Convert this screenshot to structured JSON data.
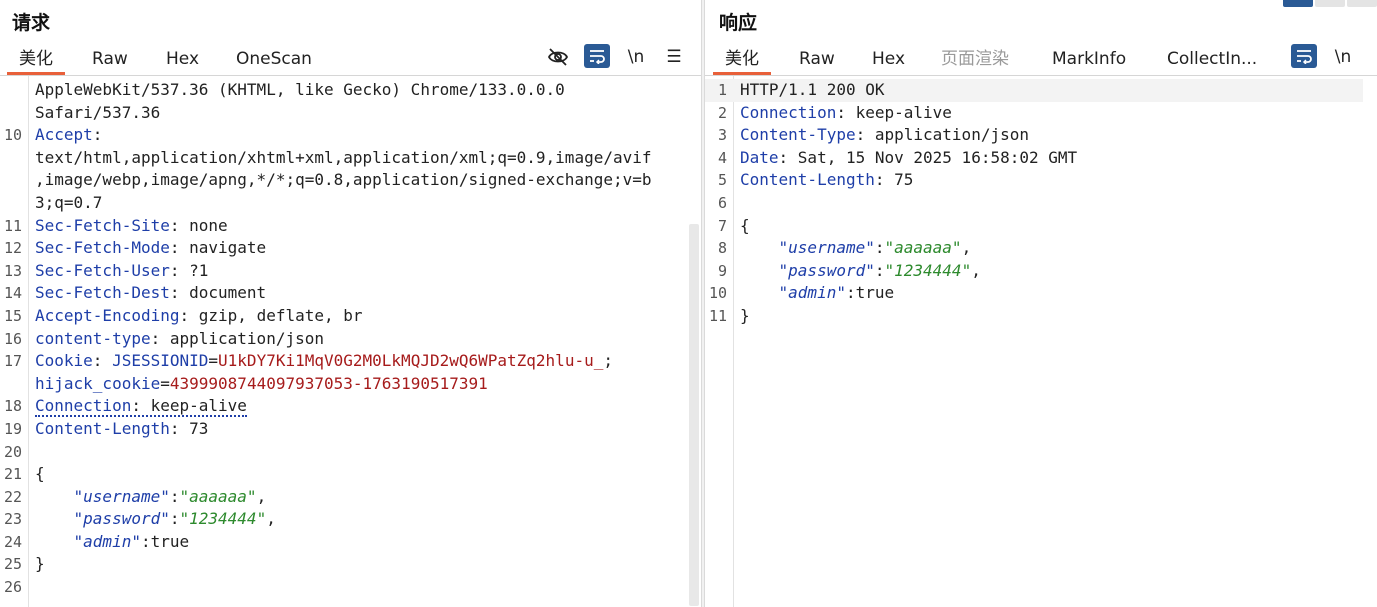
{
  "request": {
    "title": "请求",
    "tabs": [
      "美化",
      "Raw",
      "Hex",
      "OneScan"
    ],
    "tools": {
      "hide_icon": "eye-off-icon",
      "wrap_icon": "wrap-icon",
      "newline_label": "\\n",
      "menu_icon": "menu-icon"
    },
    "lines": [
      {
        "n": "",
        "text": "AppleWebKit/537.36 (KHTML, like Gecko) Chrome/133.0.0.0"
      },
      {
        "n": "",
        "text": "Safari/537.36"
      },
      {
        "n": "10",
        "key": "Accept",
        "sep": ":",
        "val": ""
      },
      {
        "n": "",
        "text": "text/html,application/xhtml+xml,application/xml;q=0.9,image/avif"
      },
      {
        "n": "",
        "text": ",image/webp,image/apng,*/*;q=0.8,application/signed-exchange;v=b"
      },
      {
        "n": "",
        "text": "3;q=0.7"
      },
      {
        "n": "11",
        "key": "Sec-Fetch-Site",
        "sep": ": ",
        "val": "none"
      },
      {
        "n": "12",
        "key": "Sec-Fetch-Mode",
        "sep": ": ",
        "val": "navigate"
      },
      {
        "n": "13",
        "key": "Sec-Fetch-User",
        "sep": ": ",
        "val": "?1"
      },
      {
        "n": "14",
        "key": "Sec-Fetch-Dest",
        "sep": ": ",
        "val": "document"
      },
      {
        "n": "15",
        "key": "Accept-Encoding",
        "sep": ": ",
        "val": "gzip, deflate, br"
      },
      {
        "n": "16",
        "key": "content-type",
        "sep": ": ",
        "val": "application/json"
      },
      {
        "n": "17",
        "key": "Cookie",
        "sep": ": ",
        "cookie": [
          {
            "k": "JSESSIONID",
            "v": "U1kDY7Ki1MqV0G2M0LkMQJD2wQ6WPatZq2hlu-u_",
            "tail": ";"
          }
        ]
      },
      {
        "n": "",
        "cookie": [
          {
            "k": "hijack_cookie",
            "v": "4399908744097937053-1763190517391",
            "tail": ""
          }
        ]
      },
      {
        "n": "18",
        "key": "Connection",
        "sep": ": ",
        "val": "keep-alive",
        "dotted": true
      },
      {
        "n": "19",
        "key": "Content-Length",
        "sep": ": ",
        "val": "73"
      },
      {
        "n": "20",
        "text": ""
      },
      {
        "n": "21",
        "text": "{"
      },
      {
        "n": "22",
        "indent": "    ",
        "jkey": "\"username\"",
        "jsep": ":",
        "jval": "\"aaaaaa\"",
        "jtail": ","
      },
      {
        "n": "23",
        "indent": "    ",
        "jkey": "\"password\"",
        "jsep": ":",
        "jval": "\"1234444\"",
        "jtail": ","
      },
      {
        "n": "24",
        "indent": "    ",
        "jkey": "\"admin\"",
        "jsep": ":",
        "jplain": "true",
        "jtail": ""
      },
      {
        "n": "25",
        "text": "}"
      },
      {
        "n": "26",
        "text": ""
      }
    ]
  },
  "response": {
    "title": "响应",
    "tabs": [
      "美化",
      "Raw",
      "Hex",
      "页面渲染",
      "MarkInfo",
      "CollectIn..."
    ],
    "tools": {
      "wrap_icon": "wrap-icon",
      "newline_label": "\\n"
    },
    "lines": [
      {
        "n": "1",
        "text": "HTTP/1.1 200 OK",
        "hl": true
      },
      {
        "n": "2",
        "key": "Connection",
        "sep": ": ",
        "val": "keep-alive"
      },
      {
        "n": "3",
        "key": "Content-Type",
        "sep": ": ",
        "val": "application/json"
      },
      {
        "n": "4",
        "key": "Date",
        "sep": ": ",
        "val": "Sat, 15 Nov 2025 16:58:02 GMT"
      },
      {
        "n": "5",
        "key": "Content-Length",
        "sep": ": ",
        "val": "75"
      },
      {
        "n": "6",
        "text": ""
      },
      {
        "n": "7",
        "text": "{"
      },
      {
        "n": "8",
        "indent": "    ",
        "jkey": "\"username\"",
        "jsep": ":",
        "jval": "\"aaaaaa\"",
        "jtail": ","
      },
      {
        "n": "9",
        "indent": "    ",
        "jkey": "\"password\"",
        "jsep": ":",
        "jval": "\"1234444\"",
        "jtail": ","
      },
      {
        "n": "10",
        "indent": "    ",
        "jkey": "\"admin\"",
        "jsep": ":",
        "jplain": "true",
        "jtail": ""
      },
      {
        "n": "11",
        "text": "}"
      }
    ]
  },
  "colors": {
    "accent": "#e8603a",
    "key": "#1e3ea8",
    "string": "#2d8a2d",
    "cookie_value": "#a61b1b",
    "tool_bg": "#2a5a95"
  }
}
